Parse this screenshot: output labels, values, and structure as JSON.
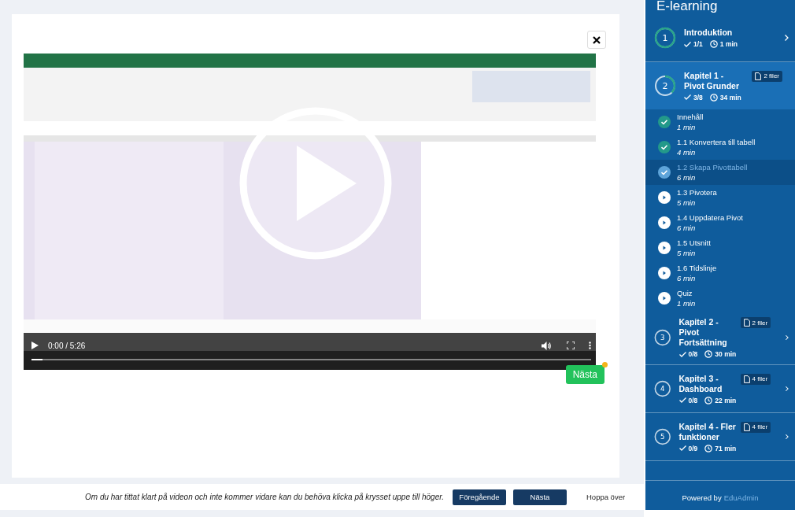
{
  "video": {
    "time": "0:00 / 5:26",
    "progress": {
      "level": 0.02
    }
  },
  "next_small": {
    "label": "Nästa",
    "notification": true
  },
  "bottom_bar": {
    "hint": "Om du har tittat klart på videon och inte kommer vidare kan du behöva klicka på krysset uppe till höger.",
    "buttons": [
      {
        "label": "Föregående",
        "kind": "filled"
      },
      {
        "label": "Nästa",
        "kind": "filled"
      },
      {
        "label": "Hoppa över",
        "kind": "plain"
      }
    ]
  },
  "sidebar": {
    "title": "E-learning",
    "chapters": [
      {
        "number": "1",
        "title": "Introduktion",
        "done": "1/1",
        "duration": "1 min",
        "level": 1,
        "expanded": false
      },
      {
        "number": "2",
        "title": "Kapitel 1 - Pivot Grunder",
        "files": "2 filer",
        "done": "3/8",
        "duration": "34 min",
        "level": 0.375,
        "expanded": true,
        "lessons": [
          {
            "title": "Innehåll",
            "duration": "1 min",
            "completed": true,
            "selected": false
          },
          {
            "title": "1.1 Konvertera till tabell",
            "duration": "4 min",
            "completed": true,
            "selected": false
          },
          {
            "title": "1.2 Skapa Pivottabell",
            "duration": "6 min",
            "completed": true,
            "selected": true
          },
          {
            "title": "1.3 Pivotera",
            "duration": "5 min",
            "completed": false,
            "selected": false
          },
          {
            "title": "1.4 Uppdatera Pivot",
            "duration": "6 min",
            "completed": false,
            "selected": false
          },
          {
            "title": "1.5 Utsnitt",
            "duration": "5 min",
            "completed": false,
            "selected": false
          },
          {
            "title": "1.6 Tidslinje",
            "duration": "6 min",
            "completed": false,
            "selected": false
          },
          {
            "title": "Quiz",
            "duration": "1 min",
            "completed": false,
            "selected": false
          }
        ]
      },
      {
        "number": "3",
        "title": "Kapitel 2 - Pivot Fortsättning",
        "files": "2 filer",
        "done": "0/8",
        "duration": "30 min",
        "level": 0,
        "expanded": false
      },
      {
        "number": "4",
        "title": "Kapitel 3 - Dashboard",
        "files": "4 filer",
        "done": "0/8",
        "duration": "22 min",
        "level": 0,
        "expanded": false
      },
      {
        "number": "5",
        "title": "Kapitel 4 - Fler funktioner",
        "files": "4 filer",
        "done": "0/9",
        "duration": "71 min",
        "level": 0,
        "expanded": false
      }
    ],
    "footer_prefix": "Powered by",
    "footer_link": "EduAdmin"
  }
}
